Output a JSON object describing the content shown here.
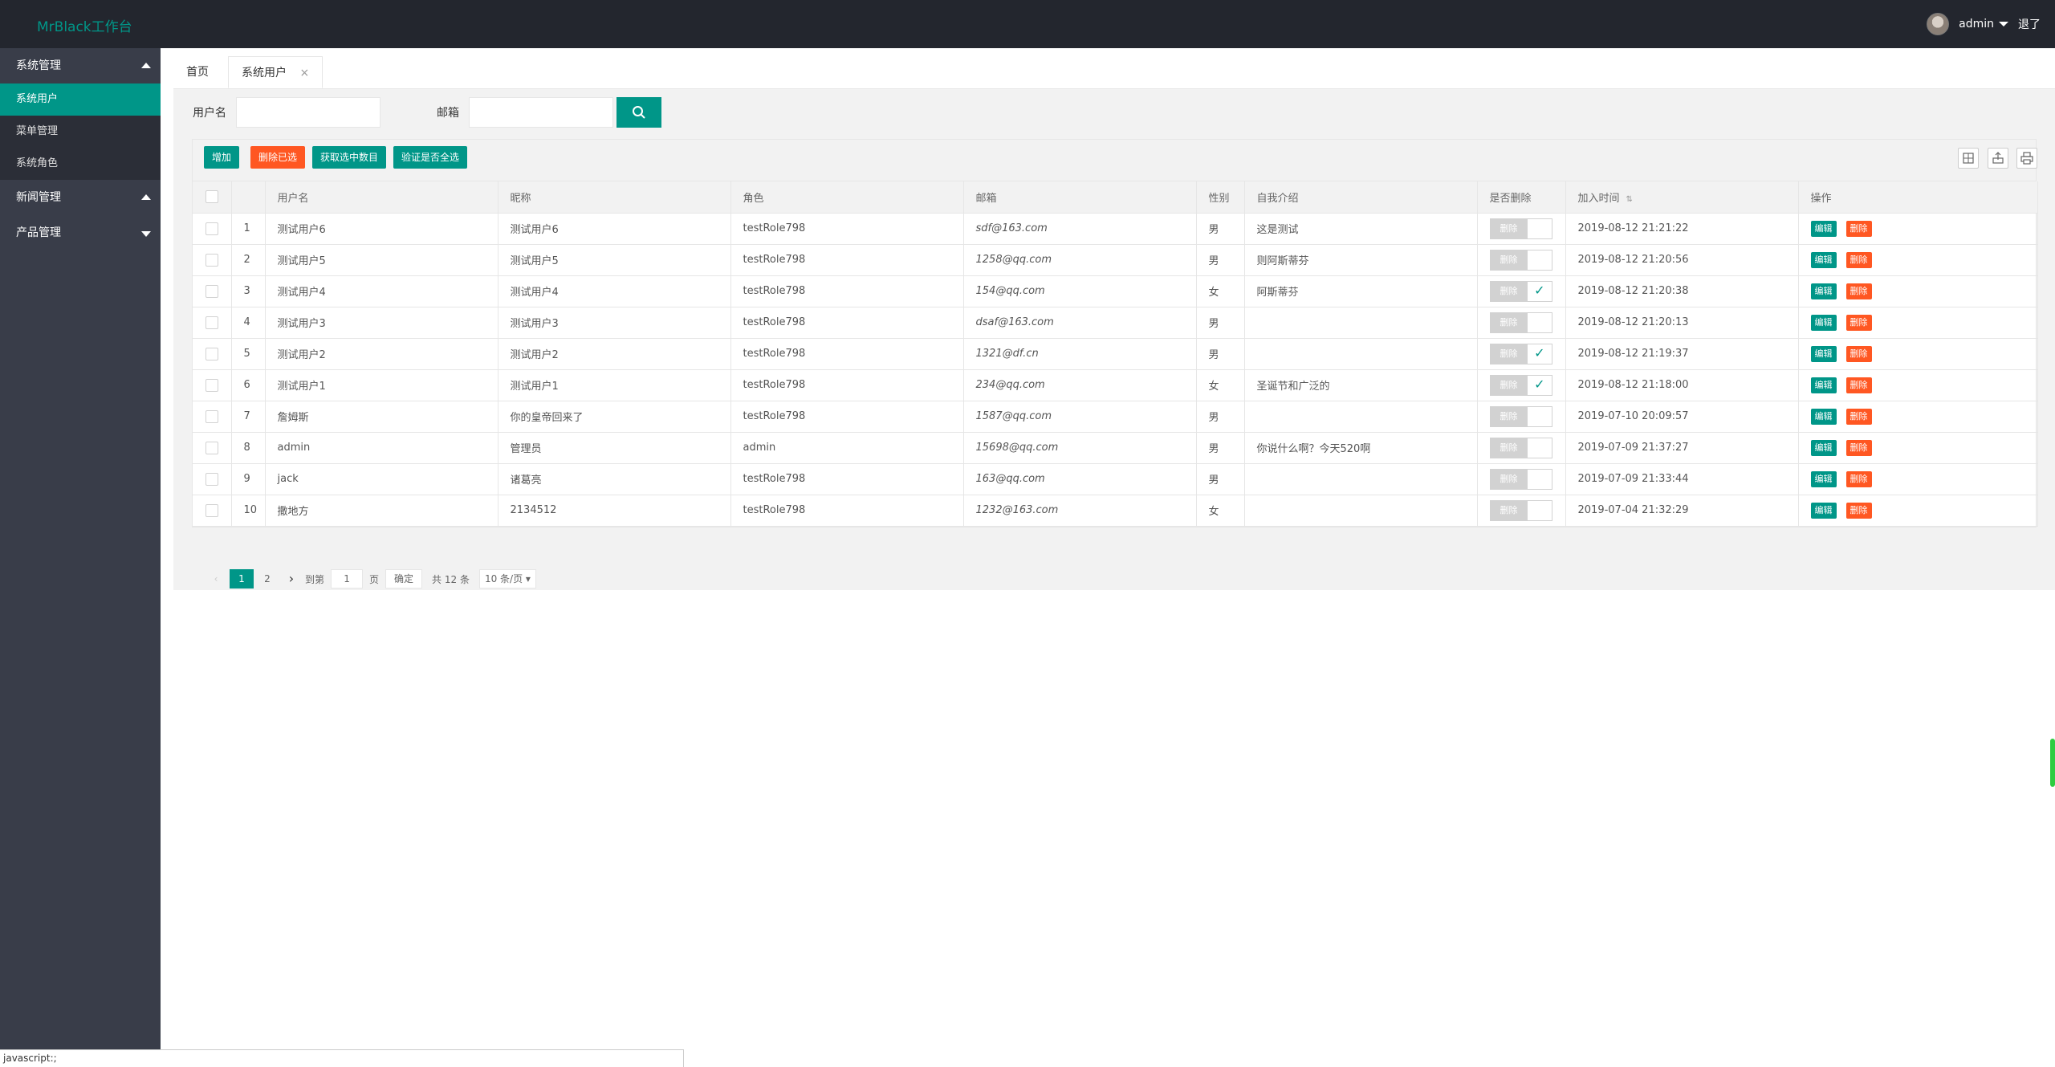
{
  "header": {
    "logo": "MrBlack工作台",
    "username": "admin",
    "logout": "退了"
  },
  "sidebar": {
    "groups": [
      {
        "label": "系统管理",
        "children": [
          "系统用户",
          "菜单管理",
          "系统角色"
        ]
      },
      {
        "label": "新闻管理"
      },
      {
        "label": "产品管理"
      }
    ]
  },
  "tabs": {
    "home": "首页",
    "current": "系统用户",
    "close": "×"
  },
  "search": {
    "username_label": "用户名",
    "email_label": "邮箱",
    "username_value": "",
    "email_value": ""
  },
  "toolbar": {
    "add": "增加",
    "delete_selected": "删除已选",
    "get_selected_count": "获取选中数目",
    "verify_all": "验证是否全选"
  },
  "table": {
    "headers": [
      "用户名",
      "昵称",
      "角色",
      "邮箱",
      "性别",
      "自我介绍",
      "是否删除",
      "加入时间",
      "操作"
    ],
    "sort_icon": "⇅",
    "switch_label": "删除",
    "edit_label": "编辑",
    "delete_label": "删除",
    "rows": [
      {
        "no": "1",
        "username": "测试用户6",
        "nickname": "测试用户6",
        "role": "testRole798",
        "email": "sdf@163.com",
        "gender": "男",
        "intro": "这是测试",
        "deleted": false,
        "time": "2019-08-12 21:21:22"
      },
      {
        "no": "2",
        "username": "测试用户5",
        "nickname": "测试用户5",
        "role": "testRole798",
        "email": "1258@qq.com",
        "gender": "男",
        "intro": "则阿斯蒂芬",
        "deleted": false,
        "time": "2019-08-12 21:20:56"
      },
      {
        "no": "3",
        "username": "测试用户4",
        "nickname": "测试用户4",
        "role": "testRole798",
        "email": "154@qq.com",
        "gender": "女",
        "intro": "阿斯蒂芬",
        "deleted": true,
        "time": "2019-08-12 21:20:38"
      },
      {
        "no": "4",
        "username": "测试用户3",
        "nickname": "测试用户3",
        "role": "testRole798",
        "email": "dsaf@163.com",
        "gender": "男",
        "intro": "",
        "deleted": false,
        "time": "2019-08-12 21:20:13"
      },
      {
        "no": "5",
        "username": "测试用户2",
        "nickname": "测试用户2",
        "role": "testRole798",
        "email": "1321@df.cn",
        "gender": "男",
        "intro": "",
        "deleted": true,
        "time": "2019-08-12 21:19:37"
      },
      {
        "no": "6",
        "username": "测试用户1",
        "nickname": "测试用户1",
        "role": "testRole798",
        "email": "234@qq.com",
        "gender": "女",
        "intro": "圣诞节和广泛的",
        "deleted": true,
        "time": "2019-08-12 21:18:00"
      },
      {
        "no": "7",
        "username": "詹姆斯",
        "nickname": "你的皇帝回来了",
        "role": "testRole798",
        "email": "1587@qq.com",
        "gender": "男",
        "intro": "",
        "deleted": false,
        "time": "2019-07-10 20:09:57"
      },
      {
        "no": "8",
        "username": "admin",
        "nickname": "管理员",
        "role": "admin",
        "email": "15698@qq.com",
        "gender": "男",
        "intro": "你说什么啊？今天520啊",
        "deleted": false,
        "time": "2019-07-09 21:37:27"
      },
      {
        "no": "9",
        "username": "jack",
        "nickname": "诸葛亮",
        "role": "testRole798",
        "email": "163@qq.com",
        "gender": "男",
        "intro": "",
        "deleted": false,
        "time": "2019-07-09 21:33:44"
      },
      {
        "no": "10",
        "username": "撒地方",
        "nickname": "2134512",
        "role": "testRole798",
        "email": "1232@163.com",
        "gender": "女",
        "intro": "",
        "deleted": false,
        "time": "2019-07-04 21:32:29"
      }
    ]
  },
  "pager": {
    "prev": "‹",
    "pages": [
      "1",
      "2"
    ],
    "next": "›",
    "goto_label": "到第",
    "goto_value": "1",
    "page_label": "页",
    "confirm": "确定",
    "total": "共 12 条",
    "per_page": "10 条/页"
  },
  "statusbar": {
    "text": "javascript:;"
  }
}
